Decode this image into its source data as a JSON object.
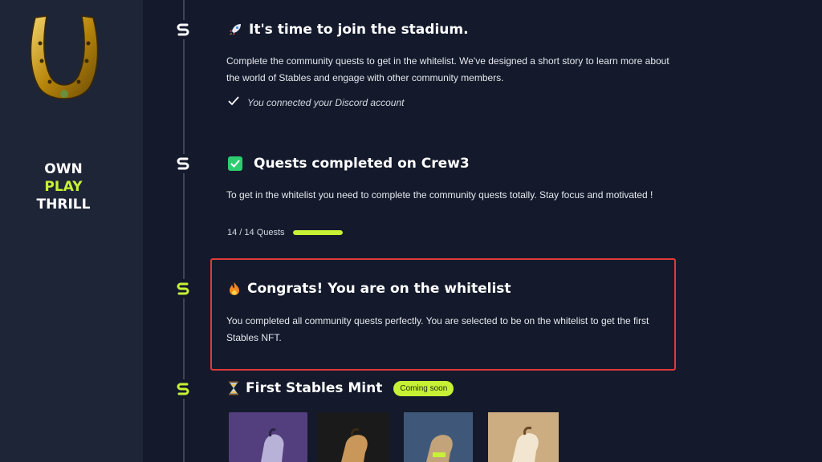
{
  "sidebar": {
    "tagline": [
      "OWN",
      "PLAY",
      "THRILL"
    ],
    "logo_icon": "golden-horseshoe",
    "accent": "#c6f135"
  },
  "steps": [
    {
      "icon": "rocket",
      "title": "It's time to join the stadium.",
      "description": "Complete the community quests to get in the whitelist. We've designed a short story to learn more about the world of Stables and engage with other community members.",
      "status": "You connected your Discord account"
    },
    {
      "icon": "green-checkbox",
      "title": "Quests completed on Crew3",
      "description": "To get in the whitelist you need to complete the community quests totally. Stay focus and motivated !",
      "progress_label": "14 / 14 Quests",
      "progress_value": 1.0
    },
    {
      "icon": "fire",
      "title": "Congrats! You are on the whitelist",
      "description": "You completed all community quests perfectly. You are selected to be on the whitelist to get the first Stables NFT."
    },
    {
      "icon": "hourglass",
      "title": "First Stables Mint",
      "badge": "Coming soon",
      "thumbnails": [
        "horse-purple",
        "horse-dark",
        "horse-blue",
        "horse-beige"
      ]
    }
  ],
  "colors": {
    "highlight_border": "#e03a3a",
    "progress": "#c6f135",
    "checkbox": "#2ecc71"
  }
}
